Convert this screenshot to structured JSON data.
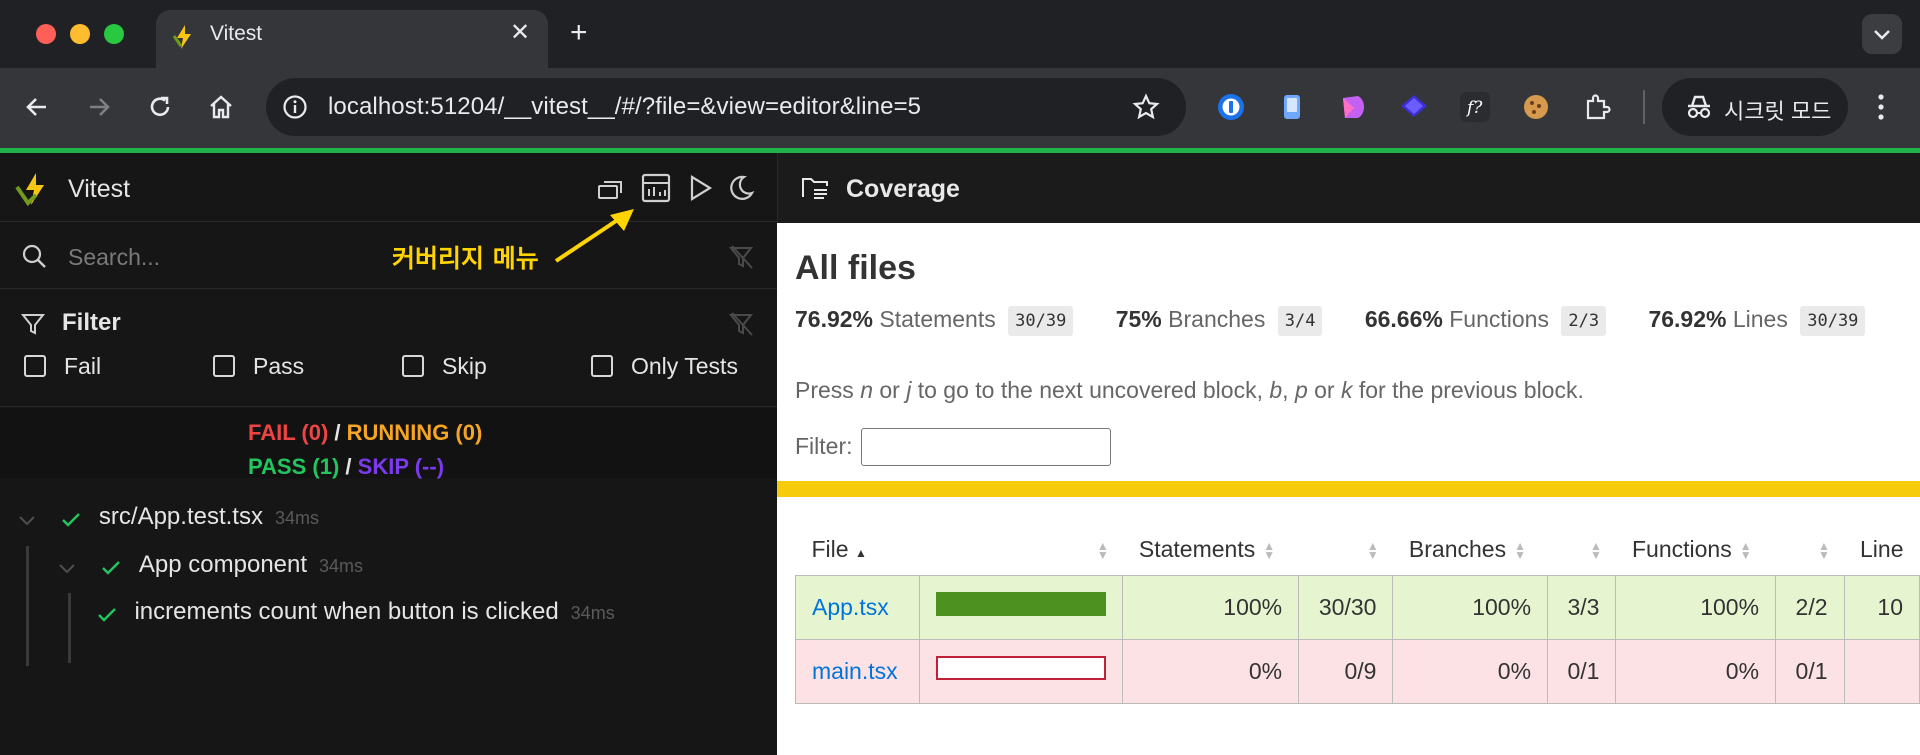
{
  "browser": {
    "tab_title": "Vitest",
    "tab_close": "✕",
    "new_tab": "+",
    "url": "localhost:51204/__vitest__/#/?file=&view=editor&line=5",
    "incognito_label": "시크릿 모드",
    "traffic_colors": [
      "#ff5f57",
      "#febc2e",
      "#28c840"
    ],
    "accent_line": "#20b34a"
  },
  "sidebar": {
    "brand": "Vitest",
    "search_placeholder": "Search...",
    "annotation": "커버리지 메뉴",
    "filter_title": "Filter",
    "filters": [
      "Fail",
      "Pass",
      "Skip",
      "Only Tests"
    ],
    "summary": {
      "fail": "FAIL (0)",
      "running": "RUNNING (0)",
      "pass": "PASS (1)",
      "skip": "SKIP (--)",
      "sep": "/"
    },
    "tree": [
      {
        "label": "src/App.test.tsx",
        "time": "34ms"
      },
      {
        "label": "App component",
        "time": "34ms"
      },
      {
        "label": "increments count when button is clicked",
        "time": "34ms"
      }
    ]
  },
  "coverage": {
    "header_title": "Coverage",
    "heading": "All files",
    "stats": [
      {
        "pct": "76.92%",
        "name": "Statements",
        "frac": "30/39"
      },
      {
        "pct": "75%",
        "name": "Branches",
        "frac": "3/4"
      },
      {
        "pct": "66.66%",
        "name": "Functions",
        "frac": "2/3"
      },
      {
        "pct": "76.92%",
        "name": "Lines",
        "frac": "30/39"
      }
    ],
    "hint_parts": [
      "Press ",
      "n",
      " or ",
      "j",
      " to go to the next uncovered block, ",
      "b",
      ", ",
      "p",
      " or ",
      "k",
      " for the previous block."
    ],
    "filter_label": "Filter:",
    "columns": [
      "File",
      "Statements",
      "Branches",
      "Functions",
      "Line"
    ],
    "rows": [
      {
        "file": "App.tsx",
        "coverage": 1.0,
        "stmt_pct": "100%",
        "stmt": "30/30",
        "br_pct": "100%",
        "br": "3/3",
        "fn_pct": "100%",
        "fn": "2/2",
        "line_pct": "10"
      },
      {
        "file": "main.tsx",
        "coverage": 0.0,
        "stmt_pct": "0%",
        "stmt": "0/9",
        "br_pct": "0%",
        "br": "0/1",
        "fn_pct": "0%",
        "fn": "0/1",
        "line_pct": ""
      }
    ]
  }
}
